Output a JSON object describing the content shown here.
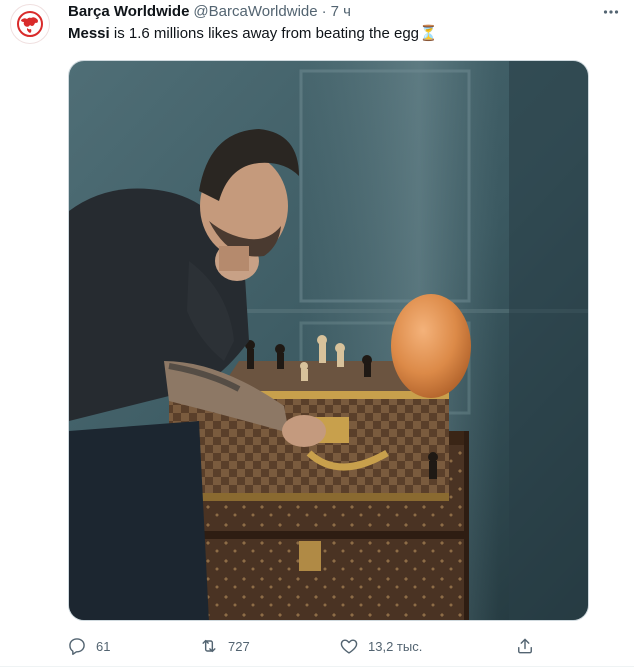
{
  "tweet": {
    "display_name": "Barça Worldwide",
    "handle": "@BarcaWorldwide",
    "separator": "·",
    "time": "7 ч",
    "text_bold": "Messi",
    "text_rest": " is 1.6 millions likes away from beating the egg",
    "text_emoji": "⏳"
  },
  "actions": {
    "reply_count": "61",
    "retweet_count": "727",
    "like_count": "13,2 тыс."
  },
  "icons": {
    "avatar": "barca-worldwide-logo",
    "more": "more-horizontal-icon",
    "reply": "reply-icon",
    "retweet": "retweet-icon",
    "like": "heart-icon",
    "share": "share-icon"
  },
  "colors": {
    "text_primary": "#0f1419",
    "text_secondary": "#536471",
    "logo_red": "#d92b2b"
  }
}
